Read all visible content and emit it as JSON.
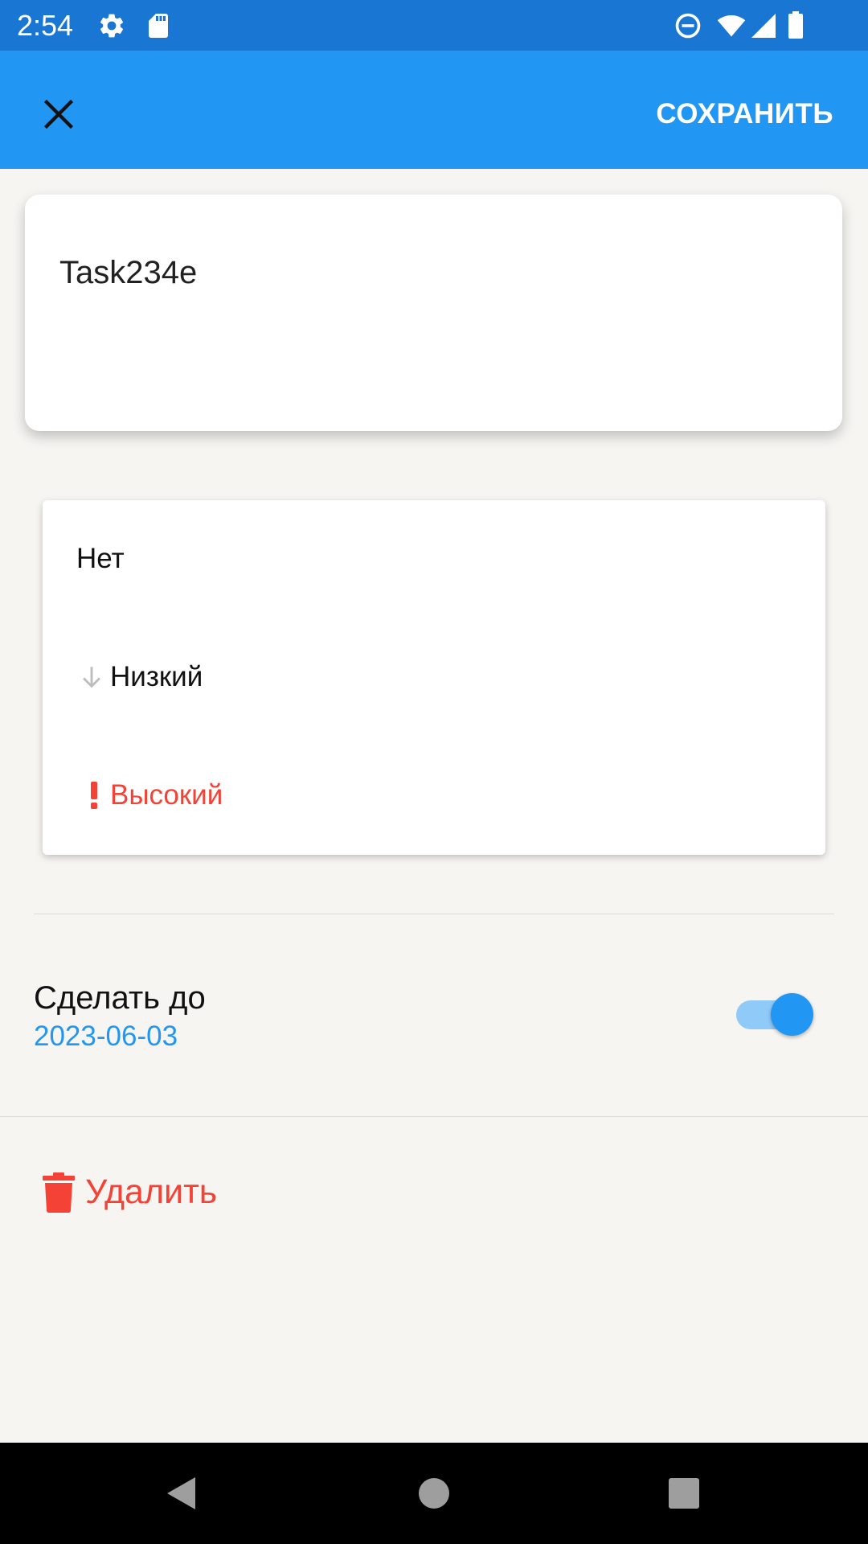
{
  "status_bar": {
    "time": "2:54",
    "icons": [
      "gear-icon",
      "sd-card-icon",
      "do-not-disturb-icon",
      "wifi-icon",
      "signal-icon",
      "battery-icon"
    ]
  },
  "app_bar": {
    "close_icon": "close-icon",
    "save_label": "СОХРАНИТЬ",
    "color": "#2196F3"
  },
  "task": {
    "title": "Task234e"
  },
  "priority_menu": {
    "items": [
      {
        "label": "Нет",
        "icon": ""
      },
      {
        "label": "Низкий",
        "icon": "arrow-down-icon"
      },
      {
        "label": "Высокий",
        "icon": "exclamation-icon",
        "color": "#F44336"
      }
    ]
  },
  "deadline": {
    "label": "Сделать до",
    "date": "2023-06-03",
    "toggle_on": true
  },
  "delete": {
    "label": "Удалить",
    "icon": "trash-icon",
    "color": "#F44336"
  },
  "nav_bar": {
    "buttons": [
      "back-icon",
      "home-icon",
      "recents-icon"
    ]
  }
}
